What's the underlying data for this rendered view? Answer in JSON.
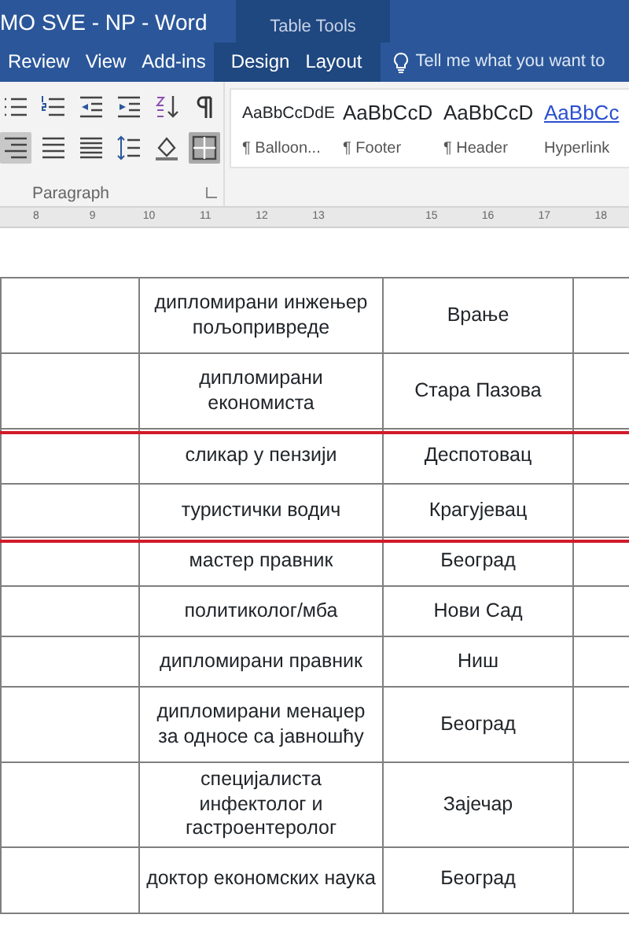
{
  "window": {
    "title": "MO SVE - NP - Word",
    "context_tab_group": "Table Tools"
  },
  "tabs": [
    {
      "label": "Review",
      "contextual": false
    },
    {
      "label": "View",
      "contextual": false
    },
    {
      "label": "Add-ins",
      "contextual": false
    },
    {
      "label": "Design",
      "contextual": true
    },
    {
      "label": "Layout",
      "contextual": true
    }
  ],
  "tell_me": {
    "placeholder": "Tell me what you want to"
  },
  "paragraph_group": {
    "label": "Paragraph",
    "tools": [
      {
        "kind": "bullets",
        "pressed": false
      },
      {
        "kind": "numbering",
        "pressed": false
      },
      {
        "kind": "outdent",
        "pressed": false
      },
      {
        "kind": "indent",
        "pressed": false
      },
      {
        "kind": "sort",
        "pressed": false
      },
      {
        "kind": "pilcrow",
        "pressed": false
      },
      {
        "kind": "align-right",
        "pressed": true
      },
      {
        "kind": "align-justify",
        "pressed": false
      },
      {
        "kind": "align-distributed",
        "pressed": false
      },
      {
        "kind": "line-spacing",
        "pressed": false
      },
      {
        "kind": "shading",
        "pressed": false
      },
      {
        "kind": "borders",
        "pressed": true
      }
    ]
  },
  "styles": [
    {
      "sample": "AaBbCcDdE",
      "name": "¶ Balloon...",
      "kind": "small"
    },
    {
      "sample": "AaBbCcD",
      "name": "¶ Footer",
      "kind": "normal"
    },
    {
      "sample": "AaBbCcD",
      "name": "¶ Header",
      "kind": "normal"
    },
    {
      "sample": "AaBbCc",
      "name": "Hyperlink",
      "kind": "link"
    }
  ],
  "ruler": {
    "numbers": [
      "8",
      "9",
      "10",
      "11",
      "12",
      "13",
      "15",
      "16",
      "17",
      "18"
    ]
  },
  "table": {
    "rows": [
      {
        "cells": [
          "",
          "дипломирани инжењер пољопривреде",
          "Врање",
          ""
        ],
        "struck": false
      },
      {
        "cells": [
          "",
          "дипломирани економиста",
          "Стара Пазова",
          ""
        ],
        "struck": false
      },
      {
        "cells": [
          "",
          "сликар у пензији",
          "Деспотовац",
          ""
        ],
        "struck": true
      },
      {
        "cells": [
          "",
          "туристички водич",
          "Крагујевац",
          ""
        ],
        "struck": false
      },
      {
        "cells": [
          "",
          "мастер правник",
          "Београд",
          ""
        ],
        "struck": true
      },
      {
        "cells": [
          "",
          "политиколог/мба",
          "Нови Сад",
          ""
        ],
        "struck": false
      },
      {
        "cells": [
          "",
          "дипломирани правник",
          "Ниш",
          ""
        ],
        "struck": false
      },
      {
        "cells": [
          "",
          "дипломирани менаџер за односе са јавношћу",
          "Београд",
          ""
        ],
        "struck": false
      },
      {
        "cells": [
          "",
          "специјалиста инфектолог и гастроентеролог",
          "Зајечар",
          ""
        ],
        "struck": false
      },
      {
        "cells": [
          "",
          "доктор економских наука",
          "Београд",
          ""
        ],
        "struck": false
      }
    ]
  }
}
